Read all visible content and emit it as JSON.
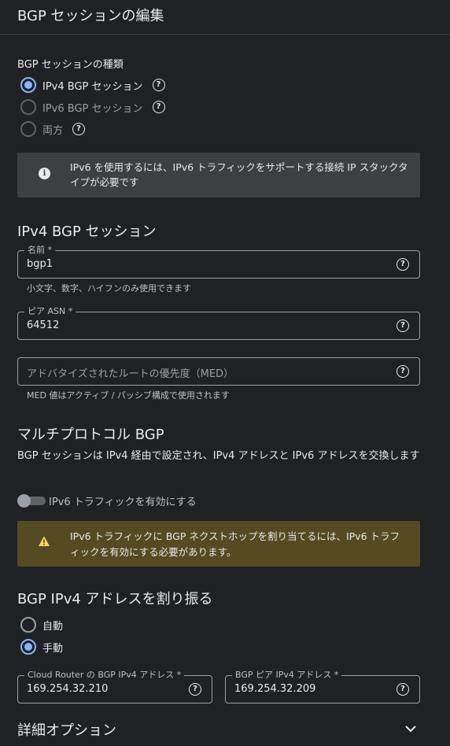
{
  "header": {
    "title": "BGP セッションの編集"
  },
  "session_type": {
    "label": "BGP セッションの種類",
    "options": [
      {
        "label": "IPv4 BGP セッション",
        "selected": true,
        "disabled": false
      },
      {
        "label": "IPv6 BGP セッション",
        "selected": false,
        "disabled": true
      },
      {
        "label": "両方",
        "selected": false,
        "disabled": true
      }
    ]
  },
  "info": {
    "icon": "info-icon",
    "text": "IPv6 を使用するには、IPv6 トラフィックをサポートする接続 IP スタックタイプが必要です"
  },
  "ipv4_section": {
    "title": "IPv4 BGP セッション",
    "name_field": {
      "label": "名前 *",
      "value": "bgp1",
      "hint": "小文字、数字、ハイフンのみ使用できます"
    },
    "asn_field": {
      "label": "ピア ASN *",
      "value": "64512"
    },
    "med_field": {
      "placeholder": "アドバタイズされたルートの優先度（MED）",
      "hint": "MED 値はアクティブ / パッシブ構成で使用されます"
    }
  },
  "multiprotocol": {
    "title": "マルチプロトコル BGP",
    "description": "BGP セッションは IPv4 経由で設定され、IPv4 アドレスと IPv6 アドレスを交換します",
    "toggle_label": "IPv6 トラフィックを有効にする",
    "toggle_on": false
  },
  "warning": {
    "icon": "warning-icon",
    "text": "IPv6 トラフィックに BGP ネクストホップを割り当てるには、IPv6 トラフィックを有効にする必要があります。"
  },
  "allocation": {
    "title": "BGP IPv4 アドレスを割り振る",
    "options": [
      {
        "label": "自動",
        "selected": false
      },
      {
        "label": "手動",
        "selected": true
      }
    ],
    "router_ip": {
      "label": "Cloud Router の BGP IPv4 アドレス *",
      "value": "169.254.32.210"
    },
    "peer_ip": {
      "label": "BGP ピア IPv4 アドレス *",
      "value": "169.254.32.209"
    }
  },
  "advanced": {
    "title": "詳細オプション",
    "icon": "chevron-down-icon"
  },
  "colors": {
    "background": "#202124",
    "accent": "#8ab4f8",
    "warning_bg": "#554a22",
    "info_bg": "#3c4043",
    "warning_icon": "#fdd663"
  }
}
